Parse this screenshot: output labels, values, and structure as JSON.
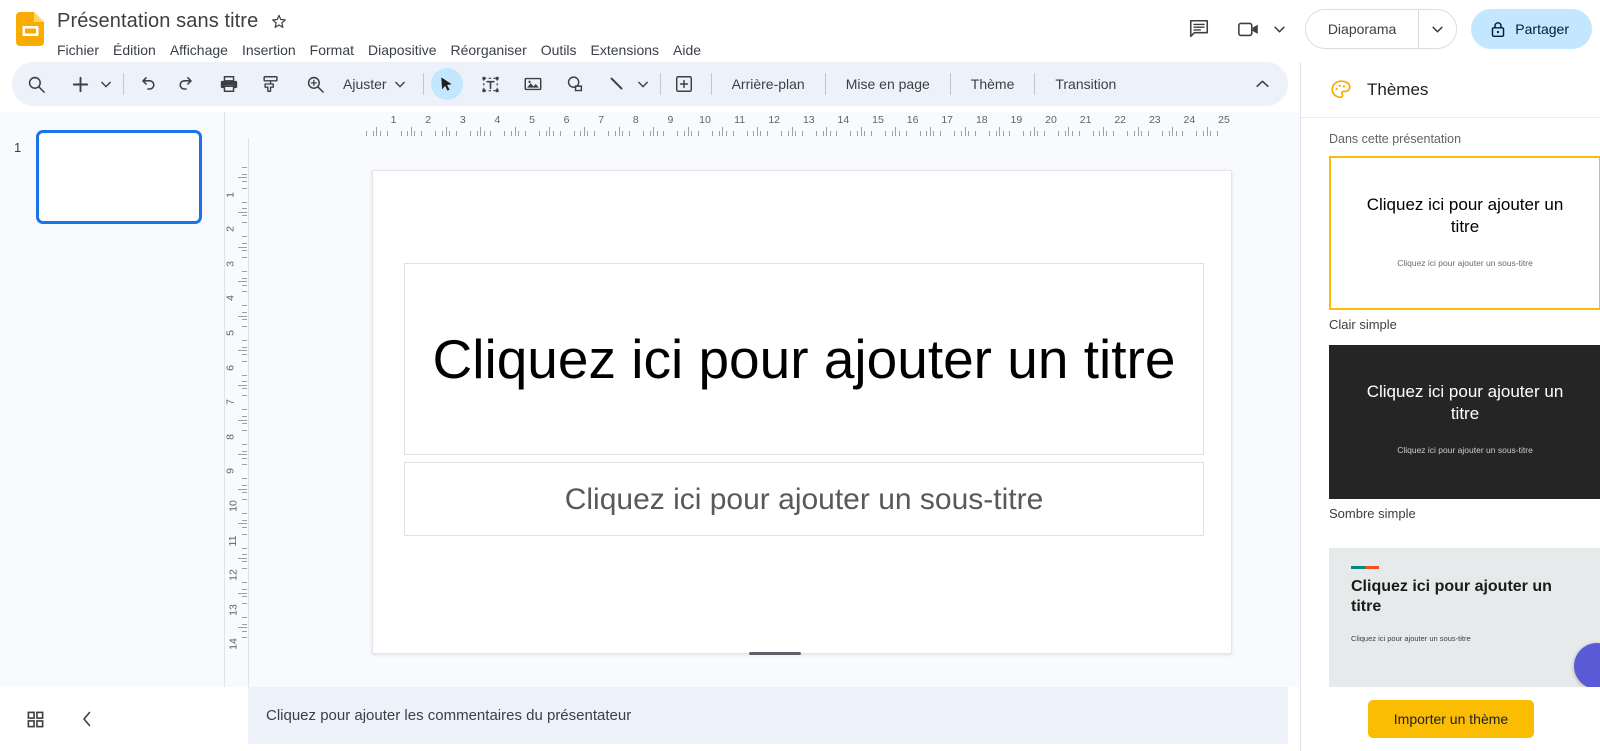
{
  "titlebar": {
    "app_icon": "slides-logo",
    "doc_title": "Présentation sans titre",
    "star_icon": "star-outline-icon",
    "menus": [
      "Fichier",
      "Édition",
      "Affichage",
      "Insertion",
      "Format",
      "Diapositive",
      "Réorganiser",
      "Outils",
      "Extensions",
      "Aide"
    ],
    "comment_icon": "comment-history-icon",
    "meet_icon": "video-camera-icon",
    "meet_caret": "chevron-down-icon",
    "slideshow_label": "Diaporama",
    "slideshow_caret": "chevron-down-icon",
    "share_lock_icon": "lock-icon",
    "share_label": "Partager",
    "share_bg": "#c2e7ff"
  },
  "toolbar": {
    "search_icon": "search-icon",
    "new_slide_icon": "plus-icon",
    "new_slide_caret": "chevron-down-icon",
    "undo_icon": "undo-icon",
    "redo_icon": "redo-icon",
    "print_icon": "printer-icon",
    "paint_icon": "paint-format-icon",
    "zoom_icon": "zoom-in-icon",
    "fit_label": "Ajuster",
    "fit_caret": "chevron-down-icon",
    "select_icon": "cursor-arrow-icon",
    "textbox_icon": "text-box-icon",
    "image_icon": "image-icon",
    "shape_icon": "shape-icon",
    "line_icon": "line-icon",
    "line_caret": "chevron-down-icon",
    "comment_icon": "add-comment-icon",
    "background_label": "Arrière-plan",
    "layout_label": "Mise en page",
    "theme_label": "Thème",
    "transition_label": "Transition",
    "collapse_icon": "chevron-up-icon",
    "bg": "#edf2fa",
    "active_bg": "#c2e7ff"
  },
  "filmstrip": {
    "slides": [
      {
        "number": "1",
        "selected": true
      }
    ],
    "selection_color": "#1a73e8"
  },
  "ruler": {
    "horizontal": [
      "1",
      "2",
      "3",
      "4",
      "5",
      "6",
      "7",
      "8",
      "9",
      "10",
      "11",
      "12",
      "13",
      "14",
      "15",
      "16",
      "17",
      "18",
      "19",
      "20",
      "21",
      "22",
      "23",
      "24",
      "25"
    ],
    "vertical": [
      "1",
      "2",
      "3",
      "4",
      "5",
      "6",
      "7",
      "8",
      "9",
      "10",
      "11",
      "12",
      "13",
      "14"
    ]
  },
  "slide": {
    "title_placeholder": "Cliquez ici pour ajouter un titre",
    "subtitle_placeholder": "Cliquez ici pour ajouter un sous-titre",
    "title_color": "#000000",
    "subtitle_color": "#595959"
  },
  "themes_panel": {
    "palette_icon": "palette-icon",
    "title": "Thèmes",
    "subtitle": "Dans cette présentation",
    "themes": [
      {
        "name": "Clair simple",
        "title_text": "Cliquez ici pour ajouter un titre",
        "subtitle_text": "Cliquez ici pour ajouter un sous-titre",
        "selected": true,
        "style": "light"
      },
      {
        "name": "Sombre simple",
        "title_text": "Cliquez ici pour ajouter un titre",
        "subtitle_text": "Cliquez ici pour ajouter un sous-titre",
        "selected": false,
        "style": "dark"
      },
      {
        "name": "",
        "title_text": "Cliquez ici pour ajouter un titre",
        "subtitle_text": "Cliquez ici pour ajouter un sous-titre",
        "selected": false,
        "style": "focus"
      }
    ],
    "import_label": "Importer un thème",
    "import_bg": "#fbbc04",
    "selected_border": "#fbbc04",
    "explore_fab": "explore-fab-icon"
  },
  "bottombar": {
    "grid_icon": "grid-view-icon",
    "collapse_icon": "chevron-left-icon",
    "notes_placeholder": "Cliquez pour ajouter les commentaires du présentateur"
  }
}
